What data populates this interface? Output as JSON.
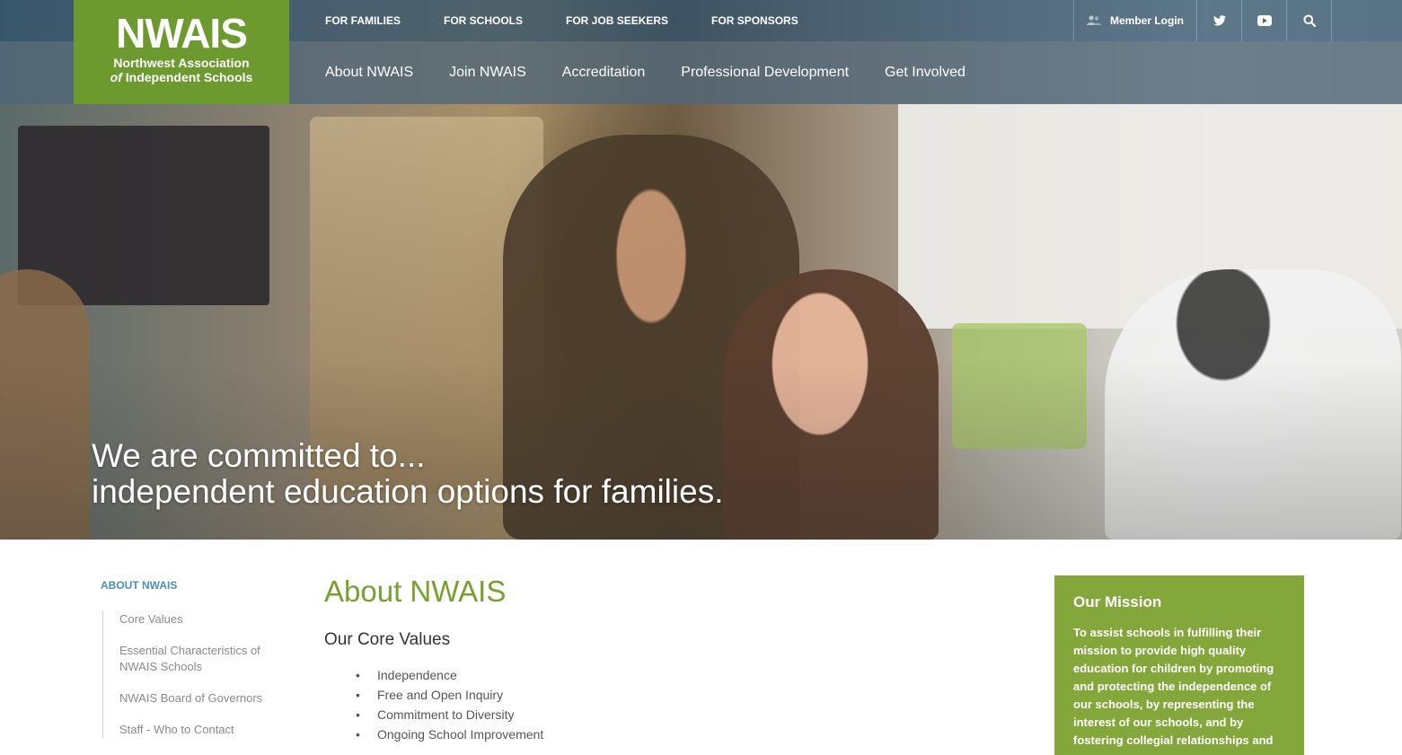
{
  "logo": {
    "mark": "NWAIS",
    "line1": "Northwest Association",
    "line2_italic": "of",
    "line2_rest": " Independent Schools",
    "color": "#6d9a2e"
  },
  "utility_nav": {
    "links": [
      "FOR FAMILIES",
      "FOR SCHOOLS",
      "FOR JOB SEEKERS",
      "FOR SPONSORS"
    ],
    "member_login": "Member Login",
    "icons": [
      "user-icon",
      "twitter-icon",
      "youtube-icon",
      "search-icon"
    ]
  },
  "main_nav": {
    "items": [
      "About NWAIS",
      "Join NWAIS",
      "Accreditation",
      "Professional Development",
      "Get Involved"
    ]
  },
  "hero": {
    "line1": "We are committed to...",
    "line2": "independent education options for families."
  },
  "sidebar": {
    "title": "ABOUT NWAIS",
    "items": [
      "Core Values",
      "Essential Characteristics of NWAIS Schools",
      "NWAIS Board of Governors",
      "Staff - Who to Contact"
    ]
  },
  "main": {
    "title": "About NWAIS",
    "section_title": "Our Core Values",
    "bullet": "•",
    "values": [
      "Independence",
      "Free and Open Inquiry",
      "Commitment to Diversity",
      "Ongoing School Improvement"
    ]
  },
  "mission": {
    "title": "Our Mission",
    "text": "To assist schools in fulfilling their mission to provide high quality education for children by promoting and protecting the independence of our schools, by representing the interest of our schools, and by fostering collegial relationships and",
    "color": "#84a73c"
  },
  "colors": {
    "accent_green": "#76a12f",
    "link_blue": "#4a8ec0",
    "nav_bar": "#50667a"
  }
}
